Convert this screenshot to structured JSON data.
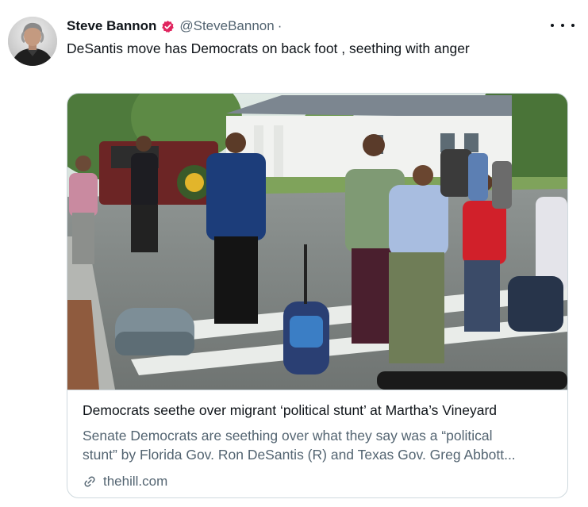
{
  "author": {
    "display_name": "Steve Bannon",
    "handle": "@SteveBannon",
    "separator": "·",
    "verified_badge_color": "#e0245e",
    "avatar_icon": "profile-photo"
  },
  "tweet": {
    "text": "DeSantis move has Democrats on back foot , seething with anger",
    "more_icon": "more-dots-icon"
  },
  "card": {
    "image_description_icon": "news-photo",
    "title": "Democrats seethe over migrant ‘political stunt’ at Martha’s Vineyard",
    "description_line1": "Senate Democrats are seething over what they say was a “political",
    "description_line2": "stunt” by Florida Gov. Ron DeSantis (R) and Texas Gov. Greg Abbott...",
    "domain": "thehill.com",
    "domain_icon": "link-icon"
  },
  "colors": {
    "text_primary": "#0f1419",
    "text_secondary": "#536471",
    "border": "#cfd9de"
  }
}
